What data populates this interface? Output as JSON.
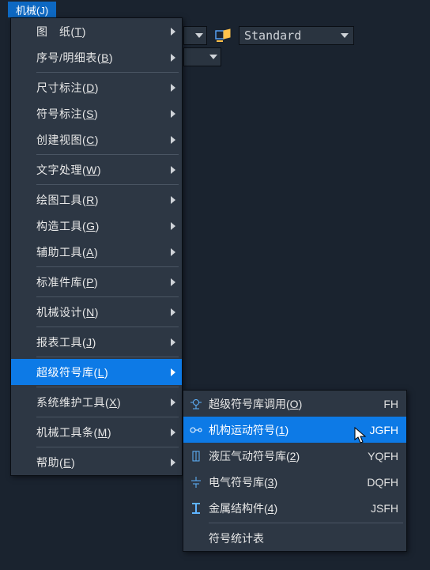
{
  "menubar": {
    "mechanical": "机械(J)"
  },
  "toolbar": {
    "standard": "Standard"
  },
  "menu": {
    "items": [
      {
        "pre": "图　纸(",
        "acc": "T",
        "post": ")",
        "arrow": true
      },
      {
        "pre": "序号/明细表(",
        "acc": "B",
        "post": ")",
        "arrow": true
      },
      "sep",
      {
        "pre": "尺寸标注(",
        "acc": "D",
        "post": ")",
        "arrow": true
      },
      {
        "pre": "符号标注(",
        "acc": "S",
        "post": ")",
        "arrow": true
      },
      {
        "pre": "创建视图(",
        "acc": "C",
        "post": ")",
        "arrow": true
      },
      "sep",
      {
        "pre": "文字处理(",
        "acc": "W",
        "post": ")",
        "arrow": true
      },
      "sep",
      {
        "pre": "绘图工具(",
        "acc": "R",
        "post": ")",
        "arrow": true
      },
      {
        "pre": "构造工具(",
        "acc": "G",
        "post": ")",
        "arrow": true
      },
      {
        "pre": "辅助工具(",
        "acc": "A",
        "post": ")",
        "arrow": true
      },
      "sep",
      {
        "pre": "标准件库(",
        "acc": "P",
        "post": ")",
        "arrow": true
      },
      "sep",
      {
        "pre": "机械设计(",
        "acc": "N",
        "post": ")",
        "arrow": true
      },
      "sep",
      {
        "pre": "报表工具(",
        "acc": "J",
        "post": ")",
        "arrow": true
      },
      "sep",
      {
        "pre": "超级符号库(",
        "acc": "L",
        "post": ")",
        "arrow": true,
        "highlight": true
      },
      "sep",
      {
        "pre": "系统维护工具(",
        "acc": "X",
        "post": ")",
        "arrow": true
      },
      "sep",
      {
        "pre": "机械工具条(",
        "acc": "M",
        "post": ")",
        "arrow": true
      },
      "sep",
      {
        "pre": "帮助(",
        "acc": "E",
        "post": ")",
        "arrow": true
      }
    ]
  },
  "submenu": {
    "items": [
      {
        "icon": "symbol-lib-icon",
        "pre": "超级符号库调用(",
        "acc": "O",
        "post": ")",
        "accel": "FH"
      },
      {
        "icon": "mechanism-icon",
        "pre": "机构运动符号(",
        "acc": "1",
        "post": ")",
        "accel": "JGFH",
        "highlight": true
      },
      {
        "icon": "hydraulic-icon",
        "pre": "液压气动符号库(",
        "acc": "2",
        "post": ")",
        "accel": "YQFH"
      },
      {
        "icon": "electrical-icon",
        "pre": "电气符号库(",
        "acc": "3",
        "post": ")",
        "accel": "DQFH"
      },
      {
        "icon": "structure-icon",
        "pre": "金属结构件(",
        "acc": "4",
        "post": ")",
        "accel": "JSFH"
      },
      "sep",
      {
        "icon": "",
        "pre": "符号统计表",
        "acc": "",
        "post": "",
        "accel": ""
      }
    ]
  }
}
